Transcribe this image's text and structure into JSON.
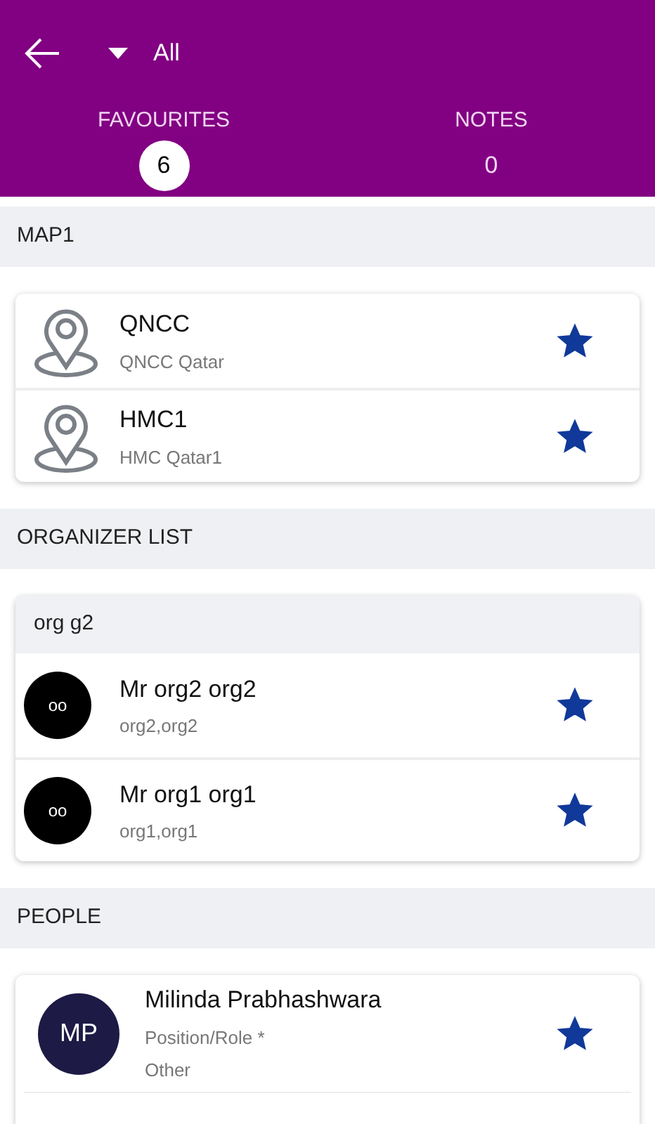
{
  "header": {
    "filter": "All"
  },
  "tabs": [
    {
      "label": "FAVOURITES",
      "count": "6",
      "selected": true
    },
    {
      "label": "NOTES",
      "count": "0",
      "selected": false
    }
  ],
  "sections": [
    {
      "title": "MAP1",
      "groups": [
        {
          "items": [
            {
              "kind": "place",
              "title": "QNCC",
              "lines": [
                "QNCC Qatar"
              ],
              "starred": true
            },
            {
              "kind": "place",
              "title": "HMC1",
              "lines": [
                "HMC Qatar1"
              ],
              "starred": true
            }
          ]
        }
      ]
    },
    {
      "title": "ORGANIZER LIST",
      "groups": [
        {
          "title": "org g2",
          "items": [
            {
              "kind": "organizer",
              "avatar": "oo",
              "title": "Mr org2 org2",
              "lines": [
                "org2,org2"
              ],
              "starred": true
            },
            {
              "kind": "organizer",
              "avatar": "oo",
              "title": "Mr org1 org1",
              "lines": [
                "org1,org1"
              ],
              "starred": true
            }
          ]
        }
      ]
    },
    {
      "title": "PEOPLE",
      "groups": [
        {
          "items": [
            {
              "kind": "person",
              "avatar": "MP",
              "title": "Milinda Prabhashwara",
              "lines": [
                "Position/Role *",
                "Other"
              ],
              "starred": true
            }
          ]
        }
      ]
    }
  ]
}
